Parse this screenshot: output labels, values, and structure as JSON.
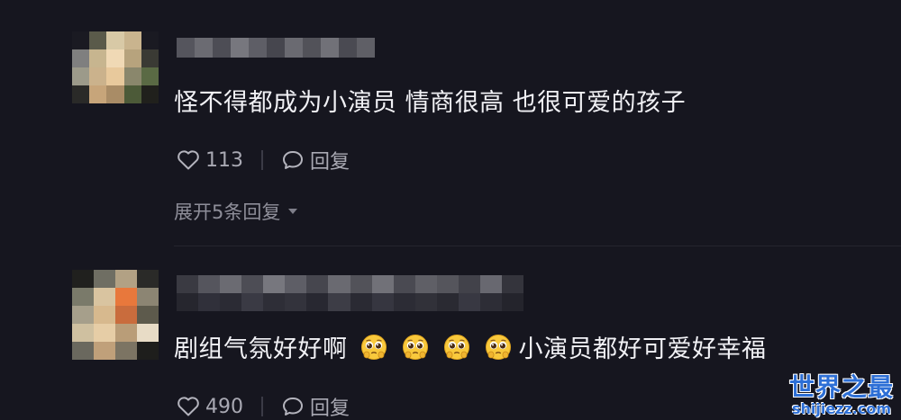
{
  "comments": [
    {
      "text": "怪不得都成为小演员 情商很高 也很可爱的孩子",
      "likes": "113",
      "reply_label": "回复",
      "expand_label": "展开5条回复"
    },
    {
      "text_before": "剧组气氛好好啊",
      "emoji_name": "pleading-face-emoji",
      "emoji_count": 4,
      "text_after": "小演员都好可爱好幸福",
      "likes": "490",
      "reply_label": "回复"
    }
  ],
  "colors": {
    "background": "#16161f",
    "text": "#f1f1f5",
    "muted": "#a9a9b3",
    "watermark": "#2d6fd6"
  },
  "icons": [
    "heart-icon",
    "comment-bubble-icon",
    "caret-down-icon"
  ],
  "watermark": {
    "title": "世界之最",
    "url": "shijiezz.com"
  }
}
